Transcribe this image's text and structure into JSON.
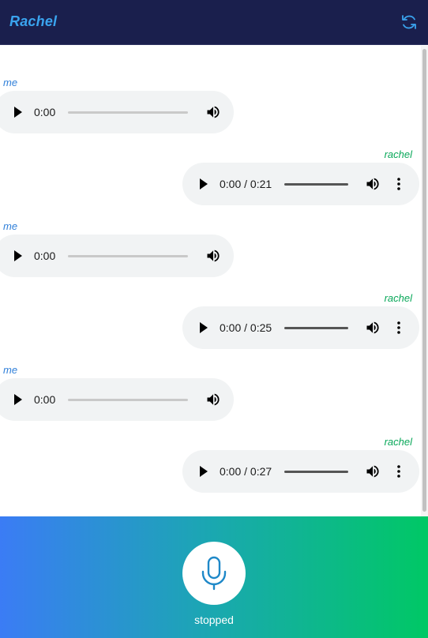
{
  "header": {
    "title": "Rachel",
    "refresh_icon": "refresh-icon",
    "background": "#1a1f4d",
    "title_color": "#3aa4ef"
  },
  "messages": [
    {
      "sender": "me",
      "time": "0:00"
    },
    {
      "sender": "rachel",
      "time": "0:00 / 0:21"
    },
    {
      "sender": "me",
      "time": "0:00"
    },
    {
      "sender": "rachel",
      "time": "0:00 / 0:25"
    },
    {
      "sender": "me",
      "time": "0:00"
    },
    {
      "sender": "rachel",
      "time": "0:00 / 0:27"
    }
  ],
  "colors": {
    "me_label": "#2f7fd9",
    "rachel_label": "#0aa85a",
    "player_bg": "#f1f3f4",
    "footer_gradient": [
      "#3b7cf5",
      "#00c865"
    ]
  },
  "footer": {
    "mic_icon": "microphone-icon",
    "status": "stopped"
  }
}
